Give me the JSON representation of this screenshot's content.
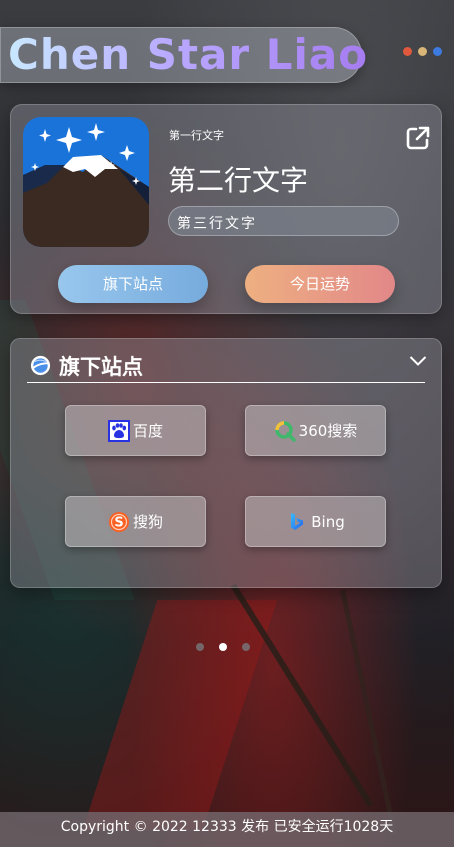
{
  "header": {
    "logo_text": "Chen Star Liao",
    "dot_colors": [
      "#e0593d",
      "#d9b577",
      "#3d7be0"
    ]
  },
  "profile": {
    "line1": "第一行文字",
    "line2": "第二行文字",
    "line3": "第三行文字",
    "external_link_icon": "external-link-icon",
    "buttons": {
      "sites": "旗下站点",
      "fortune": "今日运势"
    }
  },
  "sites_panel": {
    "title": "旗下站点",
    "sites": [
      {
        "label": "百度",
        "icon": "baidu-icon"
      },
      {
        "label": "360搜索",
        "icon": "360-search-icon"
      },
      {
        "label": "搜狗",
        "icon": "sogou-icon"
      },
      {
        "label": "Bing",
        "icon": "bing-icon"
      }
    ]
  },
  "carousel": {
    "count": 3,
    "active_index": 1
  },
  "footer": {
    "copyright": "Copyright © 2022 12333 发布 已安全运行1028天"
  }
}
